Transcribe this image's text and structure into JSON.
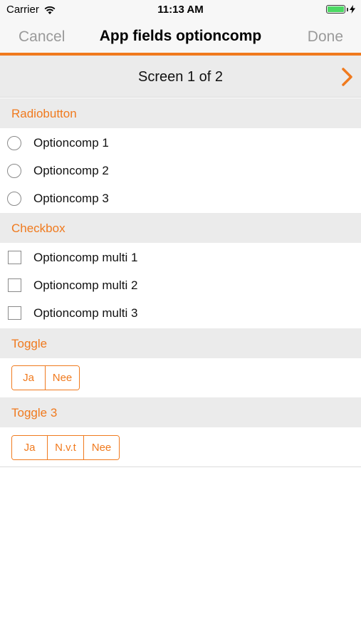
{
  "status_bar": {
    "carrier": "Carrier",
    "time": "11:13 AM"
  },
  "nav": {
    "cancel": "Cancel",
    "title": "App fields optioncomp",
    "done": "Done",
    "accent": "#f07a1e"
  },
  "pager": {
    "text": "Screen 1 of 2"
  },
  "sections": {
    "radiobutton": {
      "title": "Radiobutton",
      "options": [
        "Optioncomp 1",
        "Optioncomp 2",
        "Optioncomp 3"
      ]
    },
    "checkbox": {
      "title": "Checkbox",
      "options": [
        "Optioncomp multi 1",
        "Optioncomp multi 2",
        "Optioncomp multi 3"
      ]
    },
    "toggle": {
      "title": "Toggle",
      "buttons": [
        "Ja",
        "Nee"
      ]
    },
    "toggle3": {
      "title": "Toggle 3",
      "buttons": [
        "Ja",
        "N.v.t",
        "Nee"
      ]
    }
  }
}
